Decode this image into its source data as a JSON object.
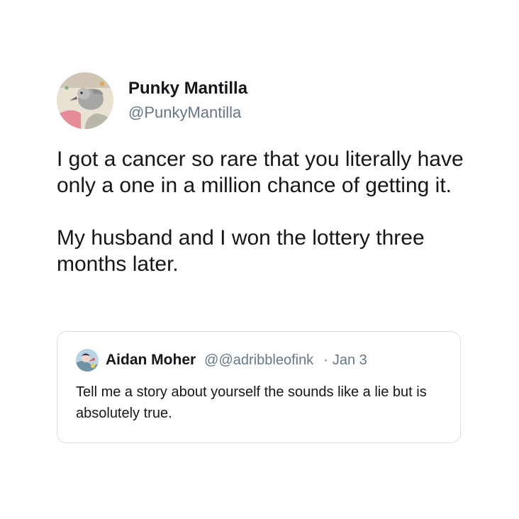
{
  "tweet": {
    "author": {
      "display_name": "Punky Mantilla",
      "handle": "@PunkyMantilla",
      "avatar_icon": "profile-photo-bird"
    },
    "paragraphs": [
      "I got a cancer so rare that you literally have only a one in a million chance of getting it.",
      "My husband and I won the lottery three months later."
    ]
  },
  "quoted_tweet": {
    "author": {
      "display_name": "Aidan Moher",
      "handle": "@@adribbleofink",
      "avatar_icon": "profile-photo-illustration"
    },
    "separator": "·",
    "date": "Jan 3",
    "text": "Tell me a story about yourself the sounds like a lie but is absolutely true."
  },
  "colors": {
    "text_primary": "#14171a",
    "text_secondary": "#657786",
    "border": "#d9dee2",
    "background": "#ffffff"
  }
}
